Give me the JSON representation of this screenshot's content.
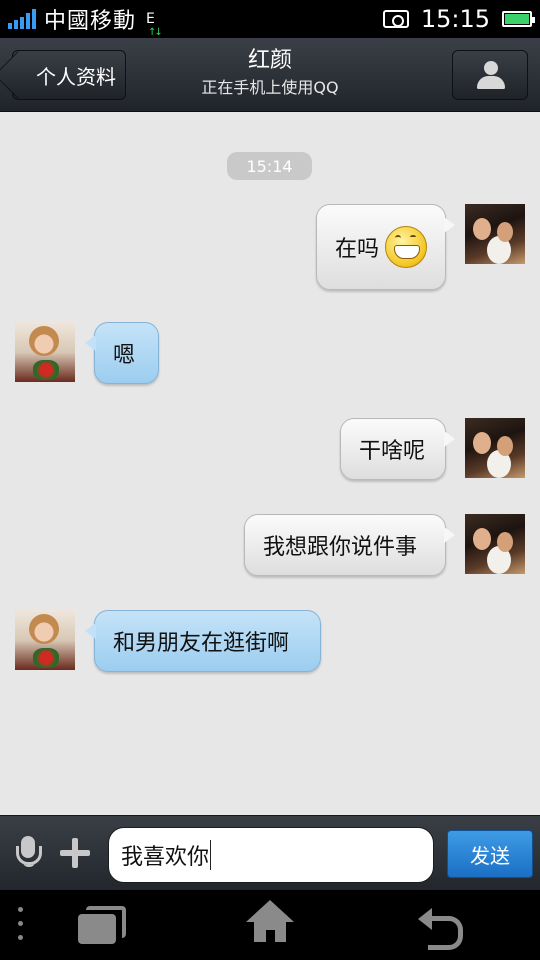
{
  "status_bar": {
    "carrier": "中國移動",
    "network": "E",
    "time": "15:15",
    "battery_level": 1.0,
    "icons": [
      "signal-icon",
      "network-activity-icon",
      "screenshot-icon",
      "battery-icon"
    ]
  },
  "header": {
    "back_label": "个人资料",
    "title": "红颜",
    "subtitle": "正在手机上使用QQ",
    "right_icon": "person-icon"
  },
  "chat": {
    "timestamp": "15:14",
    "messages": [
      {
        "side": "outgoing",
        "text": "在吗",
        "emoji": "grin-icon"
      },
      {
        "side": "incoming",
        "text": "嗯"
      },
      {
        "side": "outgoing",
        "text": "干啥呢"
      },
      {
        "side": "outgoing",
        "text": "我想跟你说件事"
      },
      {
        "side": "incoming",
        "text": "和男朋友在逛街啊"
      }
    ]
  },
  "composer": {
    "input_value": "我喜欢你",
    "send_label": "发送",
    "icons": [
      "microphone-icon",
      "plus-icon"
    ]
  },
  "nav_bar": {
    "icons": [
      "menu-icon",
      "recent-apps-icon",
      "home-icon",
      "back-icon"
    ]
  },
  "colors": {
    "incoming_bubble": "#a9d4f3",
    "outgoing_bubble": "#f0f0f0",
    "send_button": "#2a84d8",
    "chat_background": "#e7e7e7"
  }
}
